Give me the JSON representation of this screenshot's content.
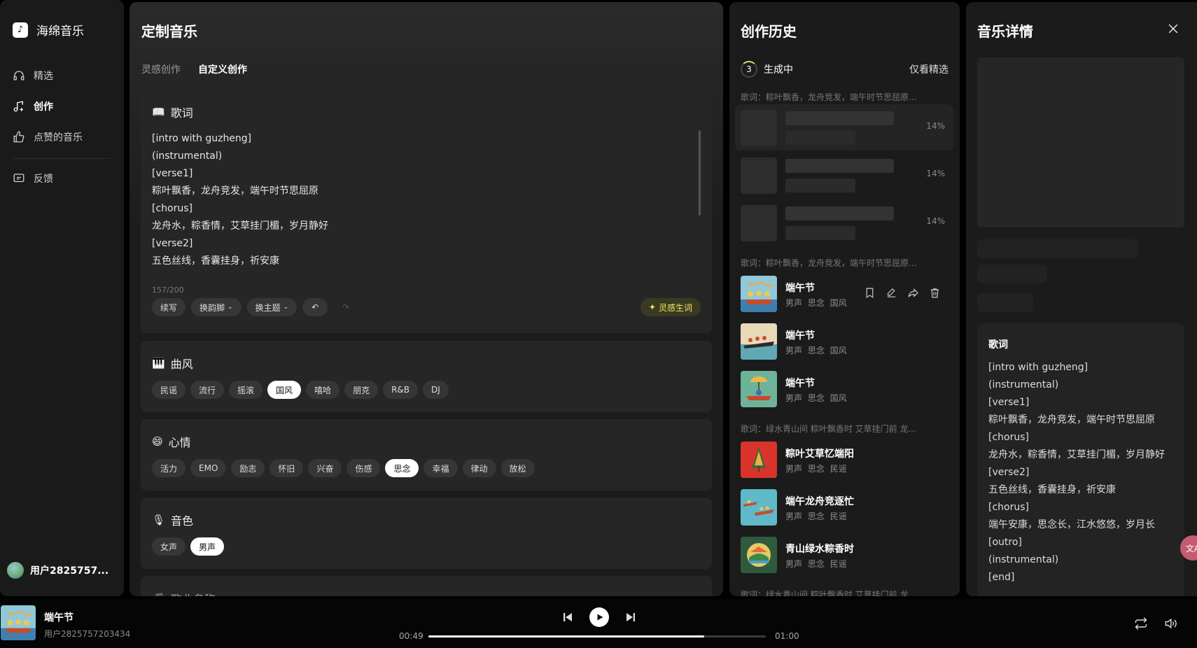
{
  "app": {
    "name": "海绵音乐"
  },
  "sidebar": {
    "items": [
      {
        "label": "精选",
        "icon": "headphones-icon"
      },
      {
        "label": "创作",
        "icon": "music-note-plus-icon",
        "active": true
      },
      {
        "label": "点赞的音乐",
        "icon": "thumbs-up-icon"
      },
      {
        "label": "反馈",
        "icon": "feedback-icon"
      }
    ],
    "user": {
      "name": "用户2825757..."
    }
  },
  "main": {
    "title": "定制音乐",
    "tabs": [
      {
        "label": "灵感创作"
      },
      {
        "label": "自定义创作",
        "active": true
      }
    ],
    "lyrics": {
      "heading": "歌词",
      "text": "[intro with guzheng]\n(instrumental)\n[verse1]\n粽叶飘香，龙舟竞发，端午时节思屈原\n[chorus]\n龙舟水，粽香情，艾草挂门楣，岁月静好\n[verse2]\n五色丝线，香囊挂身，祈安康",
      "counter": "157/200",
      "tools": {
        "continue": "续写",
        "rhyme": "换韵脚",
        "theme": "换主题"
      },
      "inspire": "灵感生词"
    },
    "style": {
      "heading": "曲风",
      "options": [
        "民谣",
        "流行",
        "摇滚",
        "国风",
        "嘻哈",
        "朋克",
        "R&B",
        "DJ"
      ],
      "selected": "国风"
    },
    "mood": {
      "heading": "心情",
      "options": [
        "活力",
        "EMO",
        "励志",
        "怀旧",
        "兴奋",
        "伤感",
        "思念",
        "幸福",
        "律动",
        "放松"
      ],
      "selected": "思念"
    },
    "voice": {
      "heading": "音色",
      "options": [
        "女声",
        "男声"
      ],
      "selected": "男声"
    },
    "song_name": {
      "heading": "歌曲名称"
    }
  },
  "history": {
    "title": "创作历史",
    "generating_count": "3",
    "generating_label": "生成中",
    "only_best": "仅看精选",
    "group1_prompt": "歌词：粽叶飘香，龙舟竞发，端午时节思屈原...",
    "pending": [
      "14%",
      "14%",
      "14%"
    ],
    "group2_prompt": "歌词：粽叶飘香，龙舟竞发，端午时节思屈原...",
    "group3_prompt": "歌词：绿水青山间 粽叶飘香时 艾草挂门前 龙...",
    "group4_prompt": "歌词：绿水青山间 粽叶飘香时 艾草挂门前 龙...",
    "songs": [
      {
        "name": "端午节",
        "tags": "男声 思念 国风"
      },
      {
        "name": "端午节",
        "tags": "男声 思念 国风"
      },
      {
        "name": "端午节",
        "tags": "男声 思念 国风"
      },
      {
        "name": "粽叶艾草忆端阳",
        "tags": "男声 思念 民谣"
      },
      {
        "name": "端午龙舟竞逐忙",
        "tags": "男声 思念 民谣"
      },
      {
        "name": "青山绿水粽香时",
        "tags": "男声 思念 民谣"
      }
    ]
  },
  "detail": {
    "title": "音乐详情",
    "lyrics_heading": "歌词",
    "lyrics_text": "[intro with guzheng]\n(instrumental)\n[verse1]\n粽叶飘香，龙舟竞发，端午时节思屈原\n[chorus]\n龙舟水，粽香情，艾草挂门楣，岁月静好\n[verse2]\n五色丝线，香囊挂身，祈安康\n[chorus]\n端午安康，思念长，江水悠悠，岁月长\n[outro]\n(instrumental)\n[end]"
  },
  "player": {
    "title": "端午节",
    "user": "用户2825757203434",
    "current_time": "00:49",
    "total_time": "01:00",
    "progress": 0.8167
  },
  "colors": {
    "accent": "#f5e663",
    "background": "#000000",
    "panel": "#1b1b1b"
  }
}
